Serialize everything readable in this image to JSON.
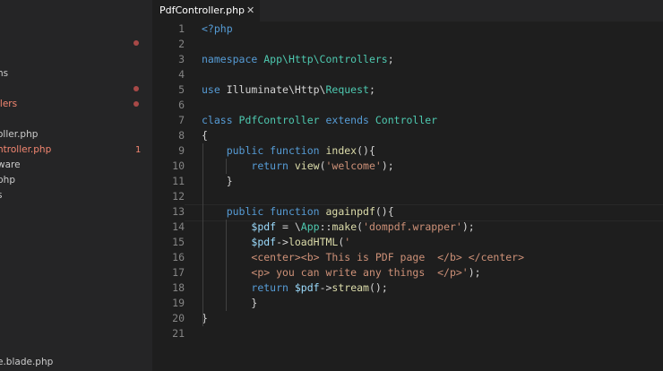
{
  "sidebar": {
    "rows": [
      {
        "label": "",
        "modified": false,
        "dot": true,
        "count": ""
      },
      {
        "label": "ns",
        "modified": false,
        "dot": false,
        "count": ""
      },
      {
        "label": "",
        "modified": false,
        "dot": true,
        "count": ""
      },
      {
        "label": "llers",
        "modified": true,
        "dot": true,
        "count": ""
      },
      {
        "label": "oller.php",
        "modified": false,
        "dot": false,
        "count": ""
      },
      {
        "label": "ntroller.php",
        "modified": true,
        "dot": false,
        "count": "1"
      },
      {
        "label": "ware",
        "modified": false,
        "dot": false,
        "count": ""
      },
      {
        "label": "php",
        "modified": false,
        "dot": false,
        "count": ""
      },
      {
        "label": "s",
        "modified": false,
        "dot": false,
        "count": ""
      },
      {
        "label": "e.blade.php",
        "modified": false,
        "dot": false,
        "count": ""
      }
    ]
  },
  "tab": {
    "title": "PdfController.php",
    "close_glyph": "✕"
  },
  "editor": {
    "lines": [
      {
        "n": "1",
        "tokens": [
          [
            "kw",
            "<?php"
          ]
        ]
      },
      {
        "n": "2",
        "tokens": []
      },
      {
        "n": "3",
        "tokens": [
          [
            "kw",
            "namespace "
          ],
          [
            "cls",
            "App\\Http\\Controllers"
          ],
          [
            "plain",
            ";"
          ]
        ]
      },
      {
        "n": "4",
        "tokens": []
      },
      {
        "n": "5",
        "tokens": [
          [
            "kw",
            "use "
          ],
          [
            "plain",
            "Illuminate\\Http\\"
          ],
          [
            "cls",
            "Request"
          ],
          [
            "plain",
            ";"
          ]
        ]
      },
      {
        "n": "6",
        "tokens": []
      },
      {
        "n": "7",
        "tokens": [
          [
            "kw",
            "class "
          ],
          [
            "cls",
            "PdfController "
          ],
          [
            "kw",
            "extends "
          ],
          [
            "cls",
            "Controller"
          ]
        ]
      },
      {
        "n": "8",
        "tokens": [
          [
            "plain",
            "{"
          ]
        ]
      },
      {
        "n": "9",
        "tokens": [
          [
            "plain",
            "    "
          ],
          [
            "kw",
            "public function "
          ],
          [
            "fn",
            "index"
          ],
          [
            "plain",
            "(){"
          ]
        ]
      },
      {
        "n": "10",
        "tokens": [
          [
            "plain",
            "        "
          ],
          [
            "kw",
            "return "
          ],
          [
            "fn",
            "view"
          ],
          [
            "plain",
            "("
          ],
          [
            "str",
            "'welcome'"
          ],
          [
            "plain",
            ");"
          ]
        ]
      },
      {
        "n": "11",
        "tokens": [
          [
            "plain",
            "    }"
          ]
        ]
      },
      {
        "n": "12",
        "tokens": []
      },
      {
        "n": "13",
        "tokens": [
          [
            "plain",
            "    "
          ],
          [
            "kw",
            "public function "
          ],
          [
            "fn",
            "againpdf"
          ],
          [
            "plain",
            "(){"
          ]
        ]
      },
      {
        "n": "14",
        "tokens": [
          [
            "plain",
            "        "
          ],
          [
            "var",
            "$pdf"
          ],
          [
            "plain",
            " = \\"
          ],
          [
            "cls",
            "App"
          ],
          [
            "plain",
            "::"
          ],
          [
            "fn",
            "make"
          ],
          [
            "plain",
            "("
          ],
          [
            "str",
            "'dompdf.wrapper'"
          ],
          [
            "plain",
            ");"
          ]
        ]
      },
      {
        "n": "15",
        "tokens": [
          [
            "plain",
            "        "
          ],
          [
            "var",
            "$pdf"
          ],
          [
            "plain",
            "->"
          ],
          [
            "fn",
            "loadHTML"
          ],
          [
            "plain",
            "("
          ],
          [
            "str",
            "'"
          ]
        ]
      },
      {
        "n": "16",
        "tokens": [
          [
            "plain",
            "        "
          ],
          [
            "str",
            "<center><b> This is PDF page  </b> </center>"
          ]
        ]
      },
      {
        "n": "17",
        "tokens": [
          [
            "plain",
            "        "
          ],
          [
            "str",
            "<p> you can write any things  </p>'"
          ],
          [
            "plain",
            ");"
          ]
        ]
      },
      {
        "n": "18",
        "tokens": [
          [
            "plain",
            "        "
          ],
          [
            "kw",
            "return "
          ],
          [
            "var",
            "$pdf"
          ],
          [
            "plain",
            "->"
          ],
          [
            "fn",
            "stream"
          ],
          [
            "plain",
            "();"
          ]
        ]
      },
      {
        "n": "19",
        "tokens": [
          [
            "plain",
            "        }"
          ]
        ]
      },
      {
        "n": "20",
        "tokens": [
          [
            "plain",
            "}"
          ]
        ]
      },
      {
        "n": "21",
        "tokens": []
      }
    ]
  }
}
